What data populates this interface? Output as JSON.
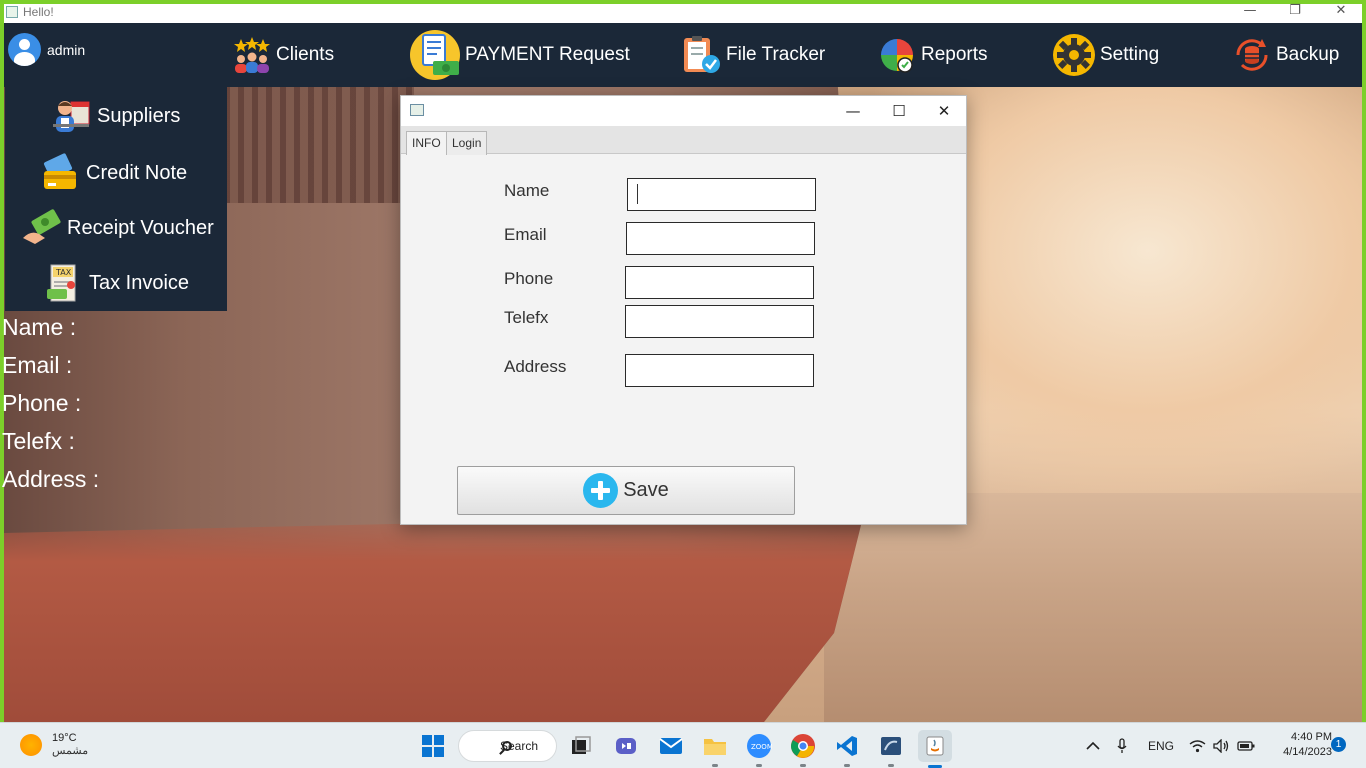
{
  "window": {
    "title": "Hello!",
    "minimize_glyph": "—",
    "maximize_glyph": "❐",
    "close_glyph": "✕"
  },
  "user": {
    "name": "admin",
    "icon": "user-avatar-icon"
  },
  "topnav": [
    {
      "label": "Clients",
      "icon": "clients-icon"
    },
    {
      "label": "PAYMENT Request",
      "icon": "payment-request-icon"
    },
    {
      "label": "File Tracker",
      "icon": "file-tracker-icon"
    },
    {
      "label": "Reports",
      "icon": "reports-icon"
    },
    {
      "label": "Setting",
      "icon": "gear-icon"
    },
    {
      "label": "Backup",
      "icon": "backup-icon"
    }
  ],
  "sidemenu": [
    {
      "label": "Suppliers",
      "icon": "suppliers-icon"
    },
    {
      "label": "Credit Note",
      "icon": "credit-note-icon"
    },
    {
      "label": "Receipt Voucher",
      "icon": "receipt-voucher-icon"
    },
    {
      "label": "Tax Invoice",
      "icon": "tax-invoice-icon"
    }
  ],
  "background_labels": [
    "Name :",
    "Email :",
    "Phone :",
    "Telefx :",
    "Address :"
  ],
  "dialog": {
    "tabs": [
      "INFO",
      "Login"
    ],
    "active_tab": "INFO",
    "fields": [
      {
        "label": "Name",
        "value": ""
      },
      {
        "label": "Email",
        "value": ""
      },
      {
        "label": "Phone",
        "value": ""
      },
      {
        "label": "Telefx",
        "value": ""
      },
      {
        "label": "Address",
        "value": ""
      }
    ],
    "save_label": "Save",
    "minimize_glyph": "—",
    "maximize_glyph": "☐",
    "close_glyph": "✕"
  },
  "taskbar": {
    "weather_temp": "19°C",
    "weather_desc": "مشمس",
    "search_label": "Search",
    "language": "ENG",
    "time": "4:40 PM",
    "date": "4/14/2023",
    "notifications": "1",
    "apps": [
      "windows-start-icon",
      "task-view-icon",
      "teams-icon",
      "mail-icon",
      "file-explorer-icon",
      "zoom-icon",
      "chrome-icon",
      "vscode-icon",
      "sql-server-icon",
      "java-icon"
    ]
  },
  "colors": {
    "nav_bg": "#1b2838",
    "window_border": "#7ccf2a",
    "save_plus": "#2ab7ee",
    "taskbar_bg": "#e8eef1"
  }
}
